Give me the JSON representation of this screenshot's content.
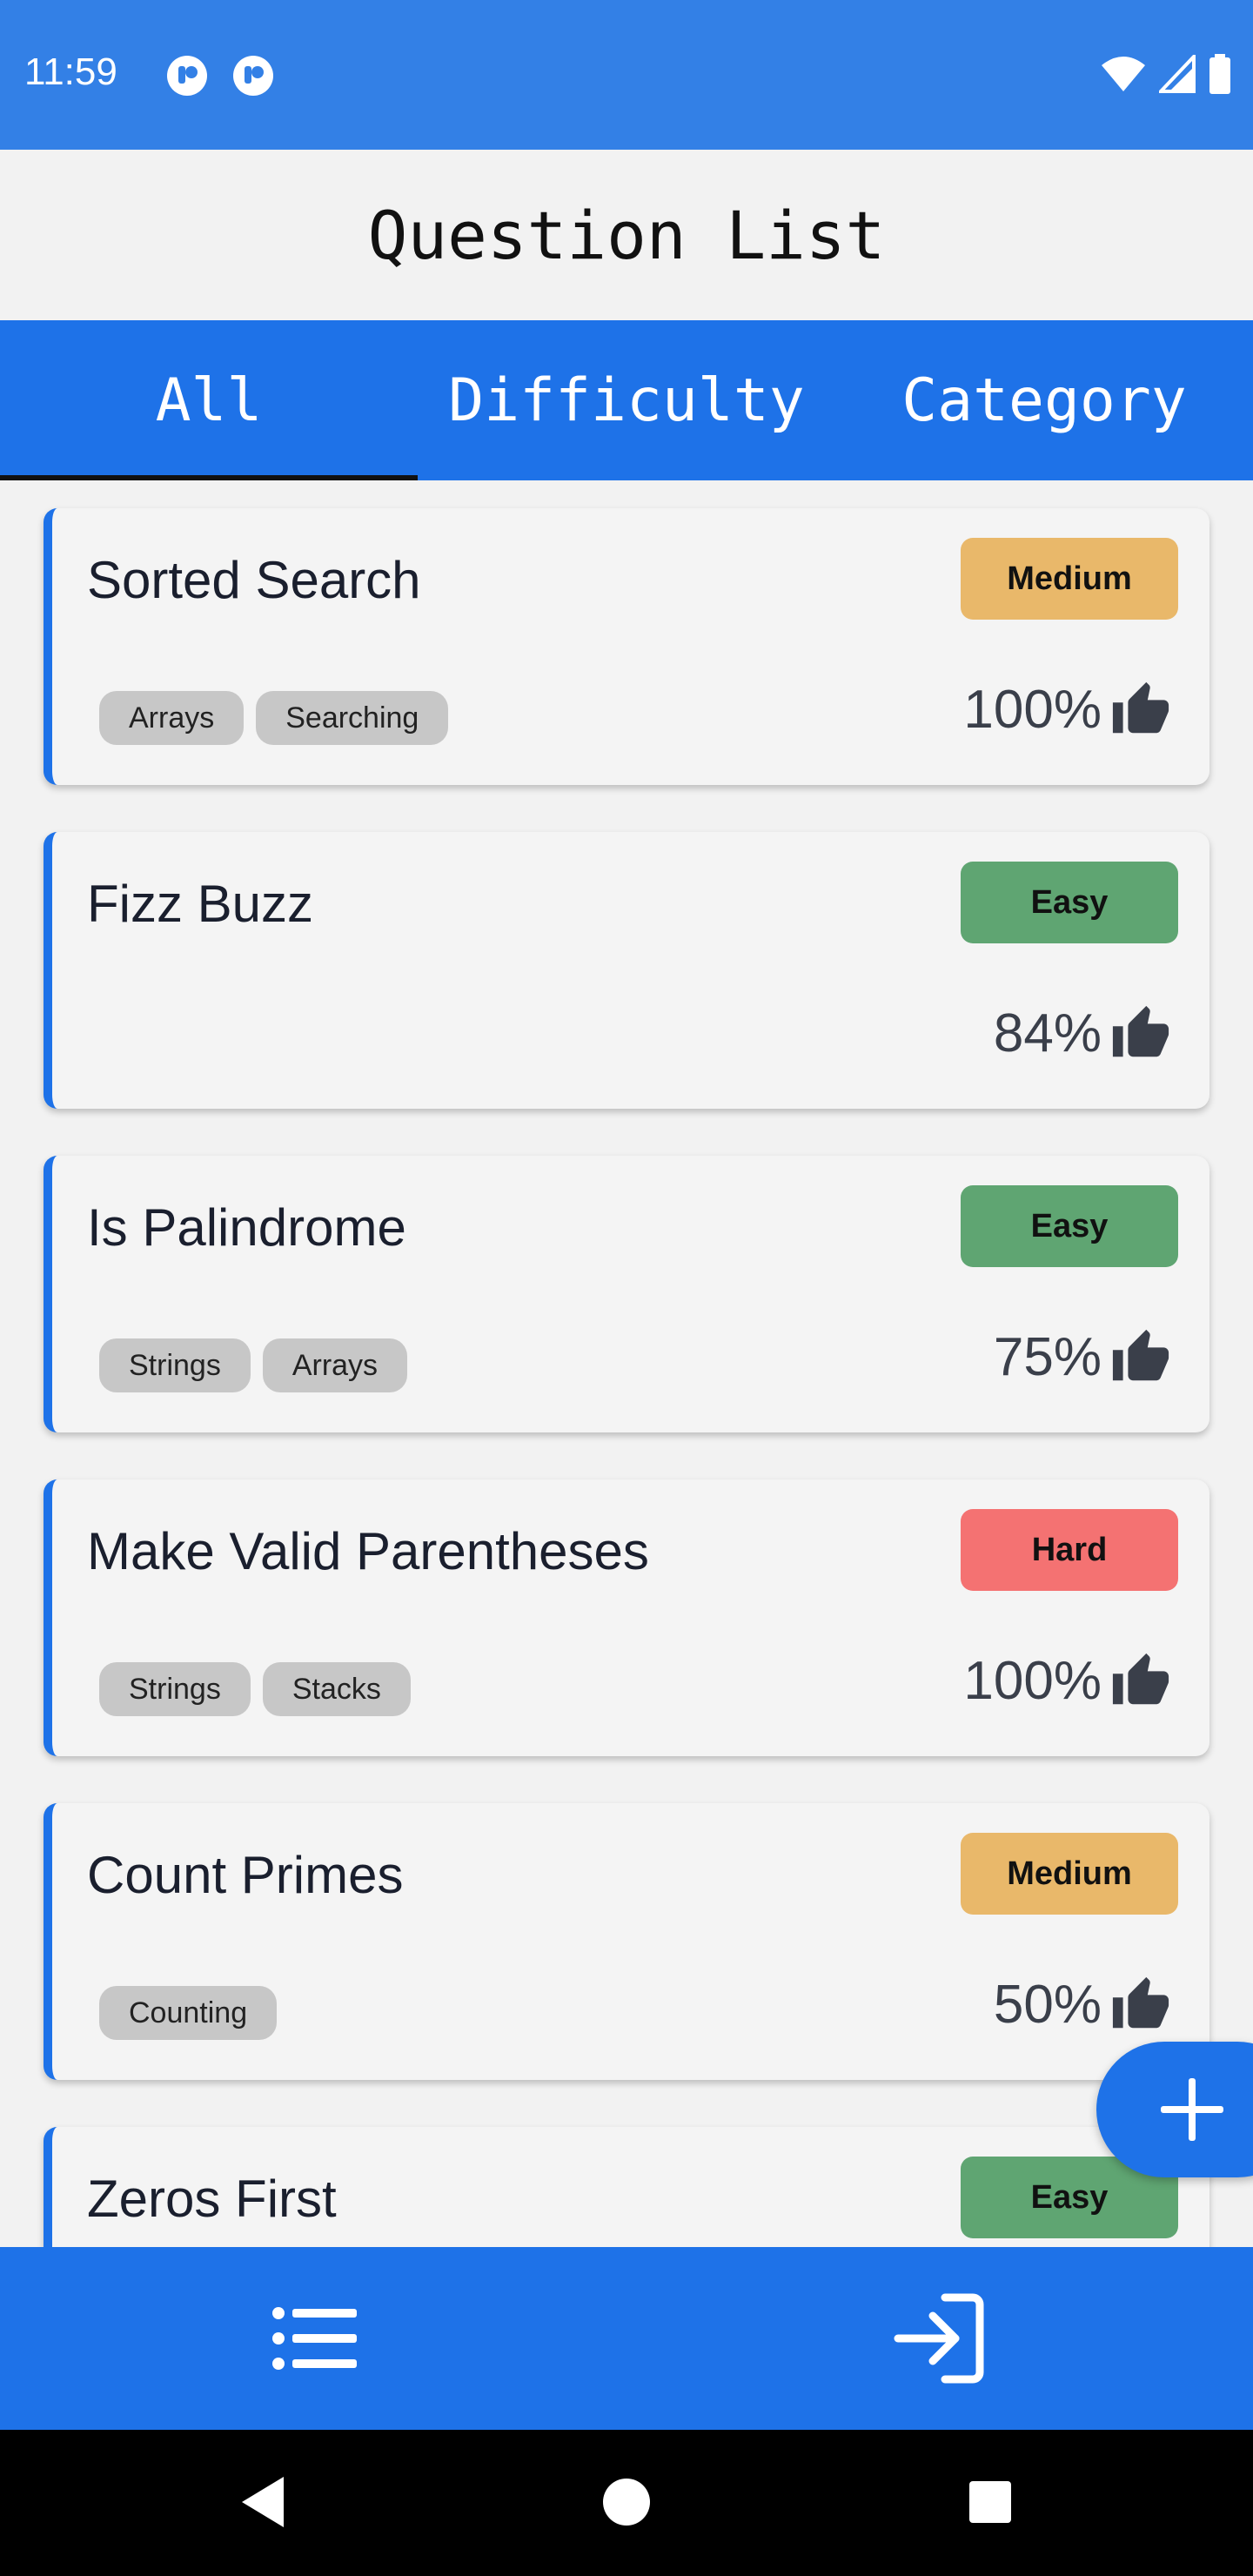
{
  "status_bar": {
    "time": "11:59"
  },
  "header": {
    "title": "Question List"
  },
  "tabs": [
    {
      "label": "All",
      "selected": true
    },
    {
      "label": "Difficulty",
      "selected": false
    },
    {
      "label": "Category",
      "selected": false
    }
  ],
  "colors": {
    "primary": "#1e72e8",
    "status_bar": "#3380e6",
    "medium": "#e9b86a",
    "easy": "#5fa572",
    "hard": "#f47272"
  },
  "questions": [
    {
      "title": "Sorted Search",
      "difficulty": "Medium",
      "tags": [
        "Arrays",
        "Searching"
      ],
      "rating": "100%"
    },
    {
      "title": "Fizz Buzz",
      "difficulty": "Easy",
      "tags": [],
      "rating": "84%"
    },
    {
      "title": "Is Palindrome",
      "difficulty": "Easy",
      "tags": [
        "Strings",
        "Arrays"
      ],
      "rating": "75%"
    },
    {
      "title": "Make Valid Parentheses",
      "difficulty": "Hard",
      "tags": [
        "Strings",
        "Stacks"
      ],
      "rating": "100%"
    },
    {
      "title": "Count Primes",
      "difficulty": "Medium",
      "tags": [
        "Counting"
      ],
      "rating": "50%"
    },
    {
      "title": "Zeros First",
      "difficulty": "Easy",
      "tags": [],
      "rating": ""
    }
  ],
  "icons": {
    "rating": "thumbs-up-icon",
    "fab": "plus-icon",
    "nav_list": "list-icon",
    "nav_login": "login-icon"
  }
}
